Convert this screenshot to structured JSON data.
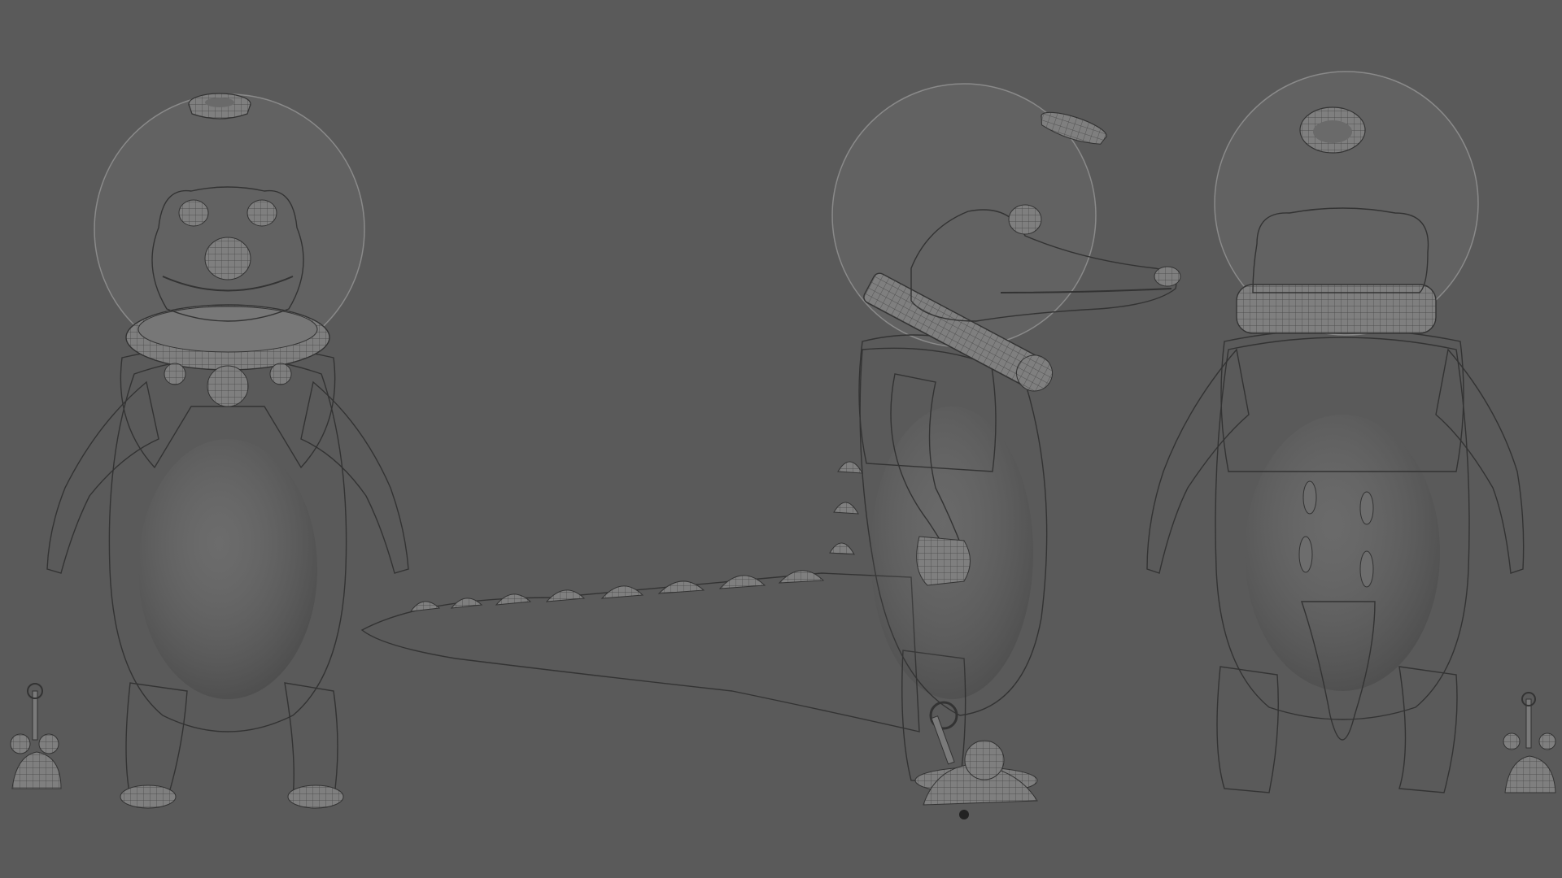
{
  "scene": {
    "background_color": "#5a5a5a",
    "model_color": "#8d8d8d",
    "wireframe_color": "#2b2b2b",
    "views": [
      {
        "id": "front",
        "props": [
          "floating-helmet-cap",
          "glass-dome",
          "windup-mouse-toy"
        ]
      },
      {
        "id": "side",
        "props": [
          "floating-helmet-cap",
          "glass-dome",
          "windup-mouse-toy",
          "spiked-tail"
        ]
      },
      {
        "id": "back",
        "props": [
          "floating-helmet-cap",
          "glass-dome",
          "windup-mouse-toy"
        ]
      }
    ]
  }
}
